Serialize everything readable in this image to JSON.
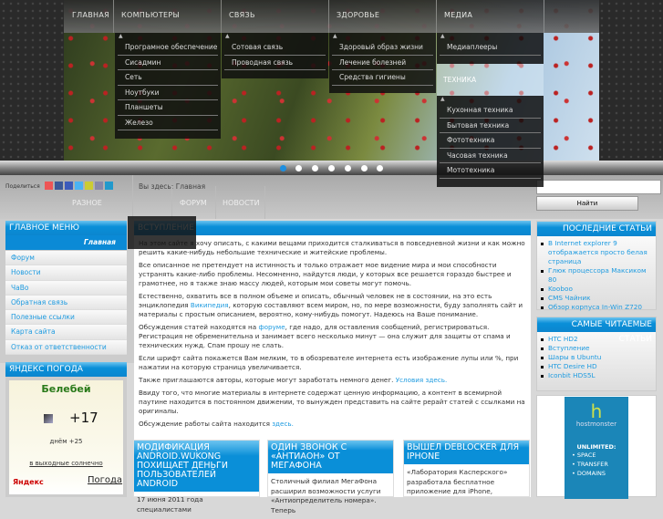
{
  "topnav": {
    "items": [
      "ГЛАВНАЯ",
      "КОМПЬЮТЕРЫ",
      "СВЯЗЬ",
      "ЗДОРОВЬЕ",
      "МЕДИА"
    ],
    "computers": [
      "Програмное обеспечение",
      "Сисадмин",
      "Сеть",
      "Ноутбуки",
      "Планшеты",
      "Железо"
    ],
    "svyaz": [
      "Сотовая связь",
      "Проводная связь"
    ],
    "health": [
      "Здоровый образ жизни",
      "Лечение болезней",
      "Средства гигиены"
    ],
    "media": [
      "Медиаплееры"
    ],
    "tech_label": "ТЕХНИКА",
    "tech": [
      "Кухонная техника",
      "Бытовая техника",
      "Фототехника",
      "Часовая техника",
      "Мототехника"
    ]
  },
  "share": {
    "label": "Поделиться"
  },
  "breadcrumb": {
    "prefix": "Вы здесь:",
    "current": "Главная"
  },
  "subnav": [
    "РАЗНОЕ",
    "ФОРУМ",
    "НОВОСТИ"
  ],
  "search": {
    "value": "",
    "button": "Найти"
  },
  "main_menu": {
    "title": "ГЛАВНОЕ МЕНЮ",
    "active": "Главная",
    "items": [
      "Форум",
      "Новости",
      "ЧаВо",
      "Обратная связь",
      "Полезные ссылки",
      "Карта сайта",
      "Отказ от ответственности"
    ]
  },
  "weather": {
    "title": "ЯНДЕКС ПОГОДА",
    "city": "Белебей",
    "temp": "+17",
    "day": "днём +25",
    "forecast": "в выходные солнечно",
    "brand": "Яндекс",
    "link": "Погода"
  },
  "article": {
    "title": "ВСТУПЛЕНИЕ",
    "p1": "На этом сайте я хочу описать, с какими вещами приходится сталкиваться в повседневной жизни и как можно решить какие-нибудь небольшие технические и житейские проблемы.",
    "p2": "Все описанное не претендует на истинность и только отражает мое видение мира и мои способности устранять какие-либо проблемы. Несомненно, найдутся люди, у которых все решается гораздо быстрее и грамотнее, но я также знаю массу людей, которым мои советы могут помочь.",
    "p3a": "Естественно, охватить все в полном объеме и описать, обычный человек не в состоянии, на это есть энциклопедия ",
    "p3link": "Википедия",
    "p3b": ", которую составляют всем миром, но, по мере возможности, буду заполнять сайт и материалы с простым описанием, вероятно, кому-нибудь помогут. Надеюсь на Ваше понимание.",
    "p4a": "Обсуждения статей находятся на ",
    "p4link": "форуме",
    "p4b": ", где надо, для оставления сообщений, регистрироваться. Регистрация не обременительна и занимает всего несколько минут — она служит для защиты от спама и технических нужд. Спам прошу не слать.",
    "p5": "Если шрифт сайта покажется Вам мелким, то в обозревателе интернета есть изображение лупы или %, при нажатии на которую страница увеличивается.",
    "p6a": "Также приглашаются авторы, которые могут заработать немного денег. ",
    "p6link": "Условия здесь.",
    "p7": "Ввиду того, что многие материалы в интернете содержат ценную информацию, а контент в всемирной паутине находится в постоянном движении, то вынужден представить на сайте рерайт статей с ссылками на оригиналы.",
    "p8a": "Обсуждение работы сайта находится ",
    "p8link": "здесь."
  },
  "news": [
    {
      "title": "МОДИФИКАЦИЯ ANDROID.WUKONG ПОХИЩАЕТ ДЕНЬГИ ПОЛЬЗОВАТЕЛЕЙ ANDROID",
      "text": "17 июня 2011 года специалистами"
    },
    {
      "title": "ОДИН ЗВОНОК С «АНТИАОН» ОТ МЕГАФОНА",
      "text": "Столичный филиал МегаФона расширил возможности услуги «Антиопределитель номера». Теперь"
    },
    {
      "title": "ВЫШЕЛ DEBLOCKER ДЛЯ IPHONE",
      "text": "«Лаборатория Касперского» разработала бесплатное приложение для iPhone,"
    }
  ],
  "latest": {
    "title": "ПОСЛЕДНИЕ СТАТЬИ",
    "items": [
      "В Internet explorer 9 отображается просто белая страница",
      "Глюк процессора Максиком 80",
      "Kooboo",
      "CMS Чайник",
      "Обзор корпуса In-Win Z720"
    ]
  },
  "popular": {
    "title": "САМЫЕ ЧИТАЕМЫЕ СТАТЬИ",
    "items": [
      "HTC HD2",
      "Вступление",
      "Шары в Ubuntu",
      "HTC Desire HD",
      "Iconbit HDS5L"
    ]
  },
  "ad": {
    "brand": "hostmonster",
    "headline": "UNLIMITED:",
    "items": [
      "SPACE",
      "TRANSFER",
      "DOMAINS"
    ]
  }
}
